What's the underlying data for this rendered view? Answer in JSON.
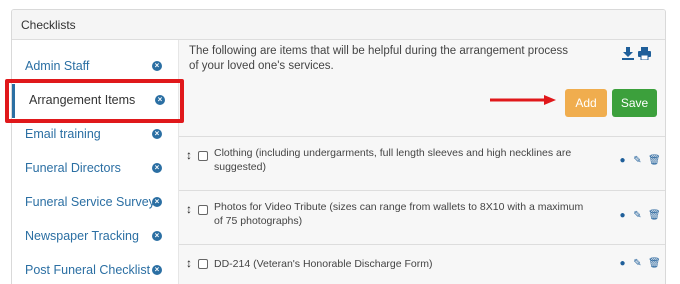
{
  "header": {
    "title": "Checklists"
  },
  "sidebar": {
    "items": [
      {
        "label": "Admin Staff"
      },
      {
        "label": "Arrangement Items"
      },
      {
        "label": "Email training"
      },
      {
        "label": "Funeral Directors"
      },
      {
        "label": "Funeral Service Survey"
      },
      {
        "label": "Newspaper Tracking"
      },
      {
        "label": "Post Funeral Checklist"
      }
    ],
    "active_index": 1,
    "remove_icon": "close-circle-icon"
  },
  "main": {
    "intro_text": "The following are items that will be helpful during the arrangement process of your loved one's services.",
    "toolbar_icons": [
      "download-icon",
      "print-icon"
    ],
    "add_label": "Add",
    "save_label": "Save",
    "items": [
      {
        "text": "Clothing (including undergarments, full length sleeves and high necklines are suggested)",
        "checked": false
      },
      {
        "text": "Photos for Video Tribute (sizes can range from wallets to 8X10 with a maximum of 75 photographs)",
        "checked": false
      },
      {
        "text": "DD-214 (Veteran's Honorable Discharge Form)",
        "checked": false
      }
    ],
    "row_icons": [
      "comment-icon",
      "pencil-icon",
      "trash-icon"
    ]
  },
  "colors": {
    "link": "#2b6fa3",
    "add": "#f0ad4e",
    "save": "#3ca03c",
    "annotation": "#e0181b"
  }
}
